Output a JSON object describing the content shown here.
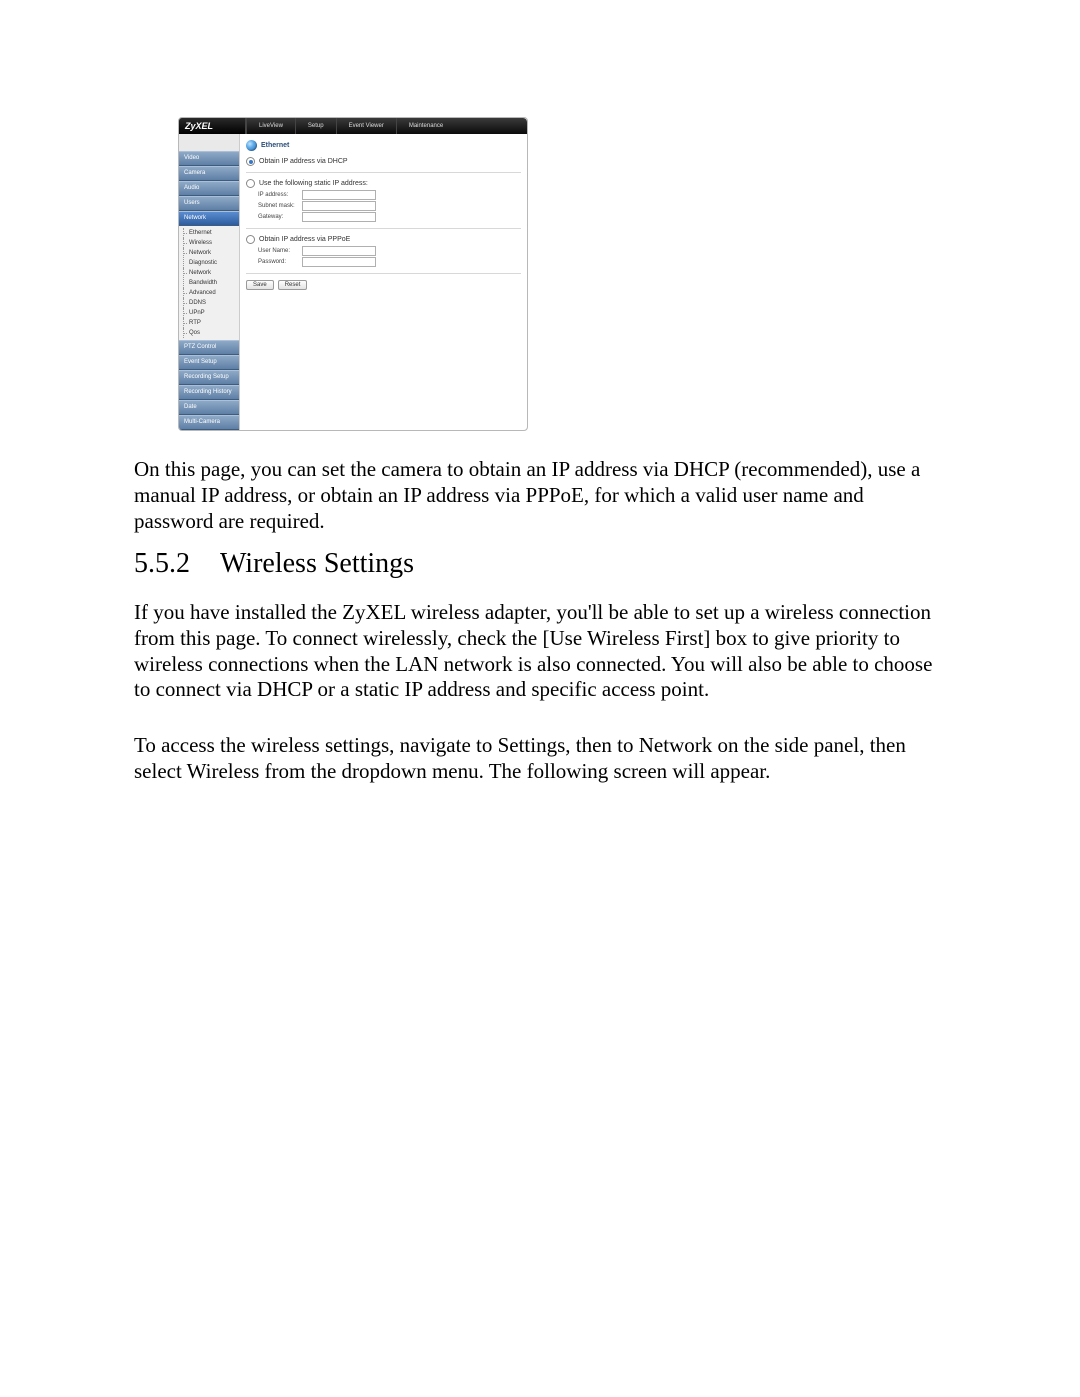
{
  "ui": {
    "brand": "ZyXEL",
    "nav": {
      "liveview": "LiveView",
      "setup": "Setup",
      "eventviewer": "Event Viewer",
      "maintenance": "Maintenance"
    },
    "sidebar": {
      "video": "Video",
      "camera": "Camera",
      "audio": "Audio",
      "users": "Users",
      "network": "Network",
      "ptz": "PTZ Control",
      "eventsetup": "Event Setup",
      "recsetup": "Recording Setup",
      "rechistory": "Recording History",
      "date": "Date",
      "multicam": "Multi-Camera"
    },
    "tree": {
      "ethernet": "Ethernet",
      "wireless": "Wireless",
      "netdiag": "Network Diagnostic",
      "netbw": "Network Bandwidth",
      "advanced": "Advanced",
      "ddns": "DDNS",
      "upnp": "UPnP",
      "rtp": "RTP",
      "qos": "Qos"
    },
    "panel": {
      "title": "Ethernet",
      "opt_dhcp": "Obtain IP address via DHCP",
      "opt_static": "Use the following static IP address:",
      "ip_label": "IP address:",
      "subnet_label": "Subnet mask:",
      "gateway_label": "Gateway:",
      "opt_pppoe": "Obtain IP address via PPPoE",
      "username_label": "User Name:",
      "password_label": "Password:",
      "ip_value": "",
      "subnet_value": "",
      "gateway_value": "",
      "username_value": "",
      "password_value": "",
      "save": "Save",
      "reset": "Reset"
    }
  },
  "doc": {
    "para1": "On this page, you can set the camera to obtain an IP address via DHCP (recommended), use a manual IP address, or obtain an IP address via PPPoE, for which a valid user name and password are required.",
    "h2_num": "5.5.2",
    "h2_title": "Wireless Settings",
    "para2": "If you have installed the ZyXEL wireless adapter, you'll be able to set up a wireless connection from this page. To connect wirelessly, check the [Use Wireless First] box to give priority to wireless connections when the LAN network is also connected. You will also be able to choose to connect via DHCP or a static IP address and specific access point.",
    "para3": "To access the wireless settings, navigate to Settings, then to Network on the side panel, then select Wireless from the dropdown menu. The following screen will appear."
  }
}
